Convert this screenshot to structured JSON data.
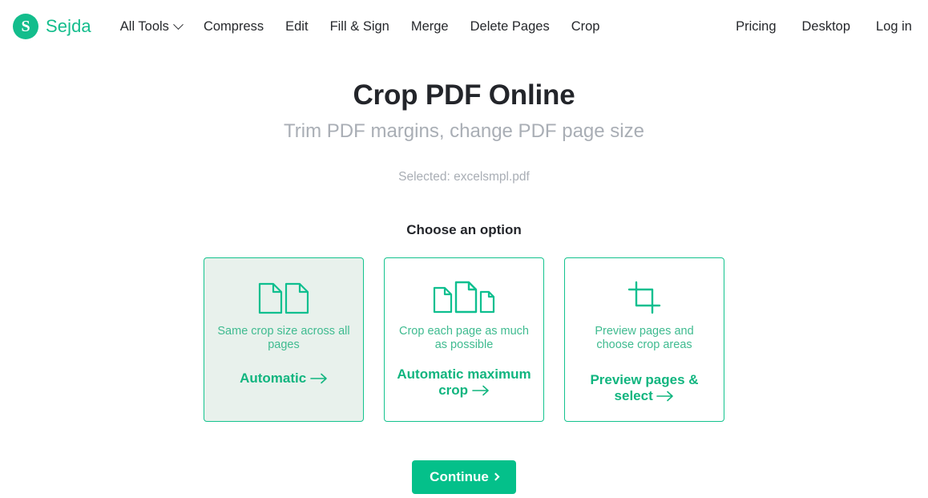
{
  "header": {
    "brand": {
      "mark_letter": "S",
      "name": "Sejda"
    },
    "nav_left": [
      {
        "label": "All Tools",
        "has_chevron": true,
        "icon": "chevron-down-icon"
      },
      {
        "label": "Compress",
        "has_chevron": false
      },
      {
        "label": "Edit",
        "has_chevron": false
      },
      {
        "label": "Fill & Sign",
        "has_chevron": false
      },
      {
        "label": "Merge",
        "has_chevron": false
      },
      {
        "label": "Delete Pages",
        "has_chevron": false
      },
      {
        "label": "Crop",
        "has_chevron": false
      }
    ],
    "nav_right": [
      {
        "label": "Pricing"
      },
      {
        "label": "Desktop"
      },
      {
        "label": "Log in"
      }
    ]
  },
  "main": {
    "title": "Crop PDF Online",
    "subtitle": "Trim PDF margins, change PDF page size",
    "selected_file": "Selected: excelsmpl.pdf",
    "choose_label": "Choose an option",
    "options": [
      {
        "icon": "two-pages-icon",
        "description": "Same crop size across all pages",
        "cta": "Automatic",
        "cta_arrow": "arrow-right-icon",
        "selected": true
      },
      {
        "icon": "three-pages-icon",
        "description": "Crop each page as much as possible",
        "cta": "Automatic maximum crop",
        "cta_arrow": "arrow-right-icon",
        "selected": false
      },
      {
        "icon": "crop-tool-icon",
        "description": "Preview pages and choose crop areas",
        "cta": "Preview pages & select",
        "cta_arrow": "arrow-right-icon",
        "selected": false
      }
    ],
    "continue_label": "Continue"
  },
  "colors": {
    "brand_green": "#13bd8c",
    "accent_green": "#04c08a",
    "card_border": "#14c38e",
    "card_selected_bg": "#e8f1ec",
    "muted_text": "#a9aeb5",
    "dark_text": "#23252a"
  }
}
